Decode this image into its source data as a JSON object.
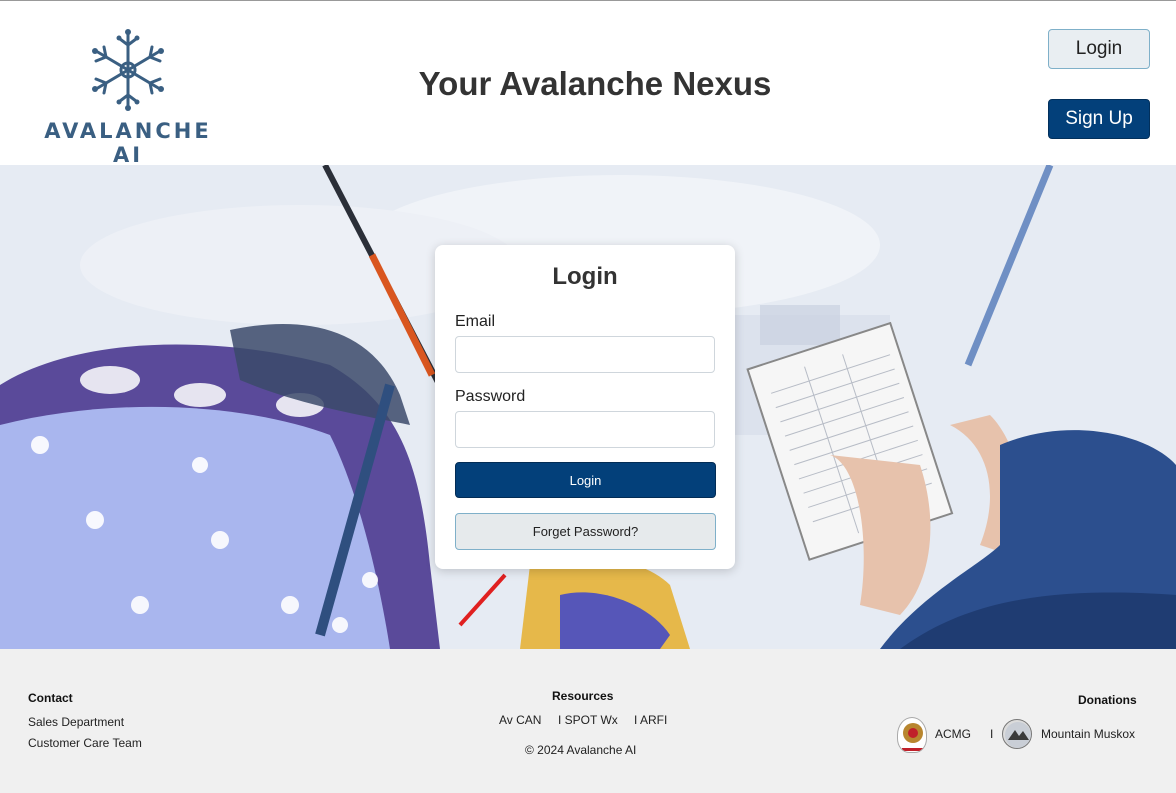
{
  "header": {
    "logo_text": "AVALANCHE AI",
    "title": "Your Avalanche Nexus",
    "login_label": "Login",
    "signup_label": "Sign Up"
  },
  "login_card": {
    "title": "Login",
    "email_label": "Email",
    "email_value": "",
    "password_label": "Password",
    "password_value": "",
    "login_button": "Login",
    "forget_button": "Forget Password?"
  },
  "footer": {
    "contact": {
      "heading": "Contact",
      "links": [
        "Sales Department",
        "Customer Care Team"
      ]
    },
    "resources": {
      "heading": "Resources",
      "links": [
        "Av CAN",
        "I SPOT Wx",
        "I ARFI"
      ],
      "copyright": "© 2024 Avalanche AI"
    },
    "donations": {
      "heading": "Donations",
      "items": [
        "ACMG",
        "Mountain Muskox"
      ],
      "separator": "I"
    }
  },
  "colors": {
    "primary": "#03407a",
    "secondary_border": "#7fb0c9",
    "logo": "#3a5f82",
    "footer_bg": "#f0f0f0"
  }
}
